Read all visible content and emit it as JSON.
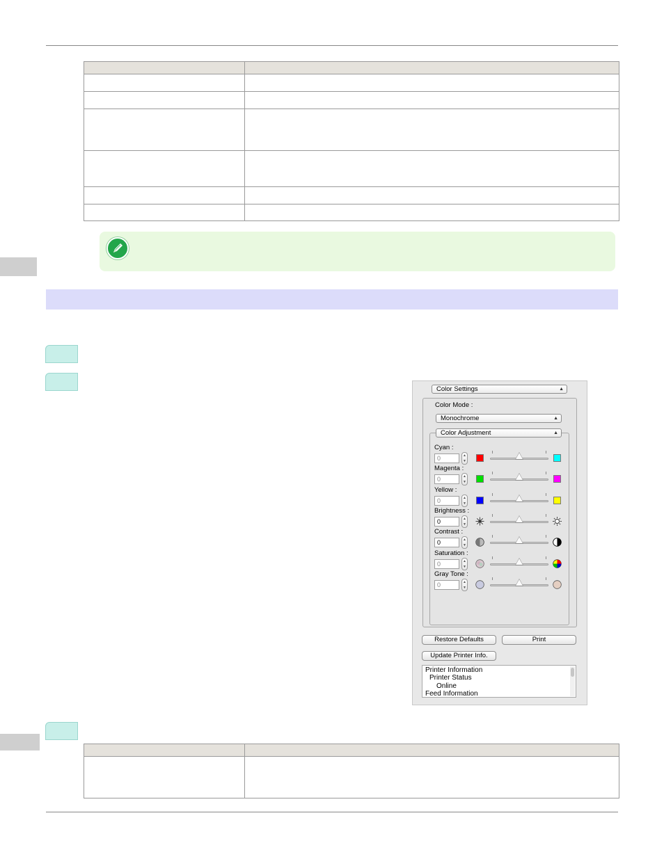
{
  "panel": {
    "top_popup": "Color Settings",
    "color_mode_label": "Color Mode :",
    "color_mode_value": "Monochrome",
    "adjustment_popup": "Color Adjustment",
    "sliders": [
      {
        "label": "Cyan :",
        "value": "0",
        "level": 0.5,
        "left_icon": "red-swatch-icon",
        "right_icon": "cyan-swatch-icon",
        "left_color": "#ff0000",
        "right_color": "#00ffff",
        "enabled": false
      },
      {
        "label": "Magenta :",
        "value": "0",
        "level": 0.5,
        "left_icon": "green-swatch-icon",
        "right_icon": "magenta-swatch-icon",
        "left_color": "#00e000",
        "right_color": "#ff00ff",
        "enabled": false
      },
      {
        "label": "Yellow :",
        "value": "0",
        "level": 0.5,
        "left_icon": "blue-swatch-icon",
        "right_icon": "yellow-swatch-icon",
        "left_color": "#0000ff",
        "right_color": "#ffff00",
        "enabled": false
      },
      {
        "label": "Brightness :",
        "value": "0",
        "level": 0.5,
        "left_icon": "dim-sun-icon",
        "right_icon": "bright-sun-icon",
        "enabled": true
      },
      {
        "label": "Contrast :",
        "value": "0",
        "level": 0.5,
        "left_icon": "low-contrast-icon",
        "right_icon": "high-contrast-icon",
        "enabled": true
      },
      {
        "label": "Saturation :",
        "value": "0",
        "level": 0.5,
        "left_icon": "low-saturation-icon",
        "right_icon": "high-saturation-icon",
        "enabled": false
      },
      {
        "label": "Gray Tone :",
        "value": "0",
        "level": 0.5,
        "left_icon": "cool-gray-icon",
        "right_icon": "warm-gray-icon",
        "enabled": false
      }
    ],
    "restore_defaults": "Restore Defaults",
    "print": "Print",
    "update_printer_info": "Update Printer Info.",
    "printer_info_lines": [
      "Printer Information",
      "Printer Status",
      "Online",
      "Feed Information"
    ]
  }
}
